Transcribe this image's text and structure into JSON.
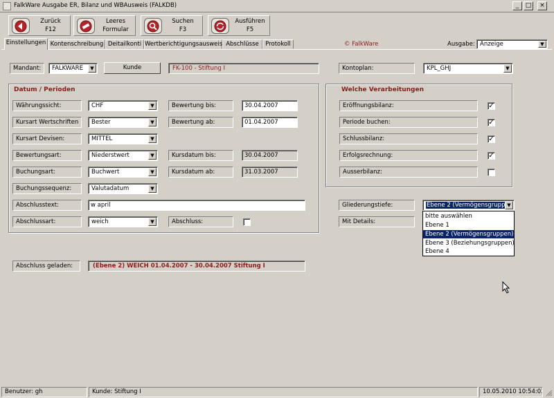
{
  "window": {
    "title": "FalkWare Ausgabe ER, Bilanz und WBAusweis  (FALKDB)",
    "min": "_",
    "max": "□",
    "close": "×"
  },
  "toolbar": [
    {
      "l1": "Zurück",
      "l2": "F12"
    },
    {
      "l1": "Leeres",
      "l2": "Formular"
    },
    {
      "l1": "Suchen",
      "l2": "F3"
    },
    {
      "l1": "Ausführen",
      "l2": "F5"
    }
  ],
  "tabs": [
    "Einstellungen",
    "Kontenschreibung",
    "Deitailkonti",
    "Wertberichtigungsausweis",
    "Abschlüsse",
    "Protokoll"
  ],
  "brand": "© FalkWare",
  "ausgabe": {
    "label": "Ausgabe:",
    "value": "Anzeige"
  },
  "mandant": {
    "label": "Mandant:",
    "value": "FALKWARE",
    "kunde_button": "Kunde",
    "kunde_value": "FK-100 - Stiftung I"
  },
  "kontoplan": {
    "label": "Kontoplan:",
    "value": "KPL_GHJ"
  },
  "datum_group": {
    "title": "Datum / Perioden",
    "waehrungssicht": {
      "label": "Währungssicht:",
      "value": "CHF"
    },
    "kursart_ws": {
      "label": "Kursart Wertschriften",
      "value": "Bester"
    },
    "kursart_dev": {
      "label": "Kursart Devisen:",
      "value": "MITTEL"
    },
    "bewertungsart": {
      "label": "Bewertungsart:",
      "value": "Niederstwert"
    },
    "buchungsart": {
      "label": "Buchungsart:",
      "value": "Buchwert"
    },
    "buchungssequenz": {
      "label": "Buchungssequenz:",
      "value": "Valutadatum"
    },
    "bewertung_bis": {
      "label": "Bewertung bis:",
      "value": "30.04.2007"
    },
    "bewertung_ab": {
      "label": "Bewertung ab:",
      "value": "01.04.2007"
    },
    "kursdatum_bis": {
      "label": "Kursdatum bis:",
      "value": "30.04.2007"
    },
    "kursdatum_ab": {
      "label": "Kursdatum ab:",
      "value": "31.03.2007"
    },
    "abschlusstext": {
      "label": "Abschlusstext:",
      "value": "w april"
    },
    "abschlussart": {
      "label": "Abschlussart:",
      "value": "weich"
    },
    "abschluss": {
      "label": "Abschluss:"
    }
  },
  "verarbeitungen": {
    "title": "Welche Verarbeitungen",
    "items": [
      {
        "label": "Eröffnungsbilanz:",
        "checked": "✓"
      },
      {
        "label": "Periode buchen:",
        "checked": "✓"
      },
      {
        "label": "Schlussbilanz:",
        "checked": "✓"
      },
      {
        "label": "Erfolgsrechnung:",
        "checked": "✓"
      },
      {
        "label": "Ausserbilanz:",
        "checked": ""
      }
    ]
  },
  "gliederung": {
    "label": "Gliederungstiefe:",
    "value": "Ebene 2 (Vermögensgruppe",
    "options": [
      "bitte auswählen",
      "Ebene 1",
      "Ebene 2 (Vermögensgruppen)",
      "Ebene 3 (Beziehungsgruppen)",
      "Ebene 4"
    ],
    "selected_index": 2
  },
  "mit_details": {
    "label": "Mit Details:"
  },
  "abschluss_geladen": {
    "label": "Abschluss geladen:",
    "value": "(Ebene 2) WEICH 01.04.2007 - 30.04.2007  Stiftung I"
  },
  "statusbar": {
    "benutzer": "Benutzer: gh",
    "kunde": "Kunde: Stiftung I",
    "datetime": "10.05.2010 10:54:03"
  },
  "colors": {
    "accent_red": "#8b1a1a",
    "selection": "#0a246a",
    "face": "#d4d0c8"
  }
}
